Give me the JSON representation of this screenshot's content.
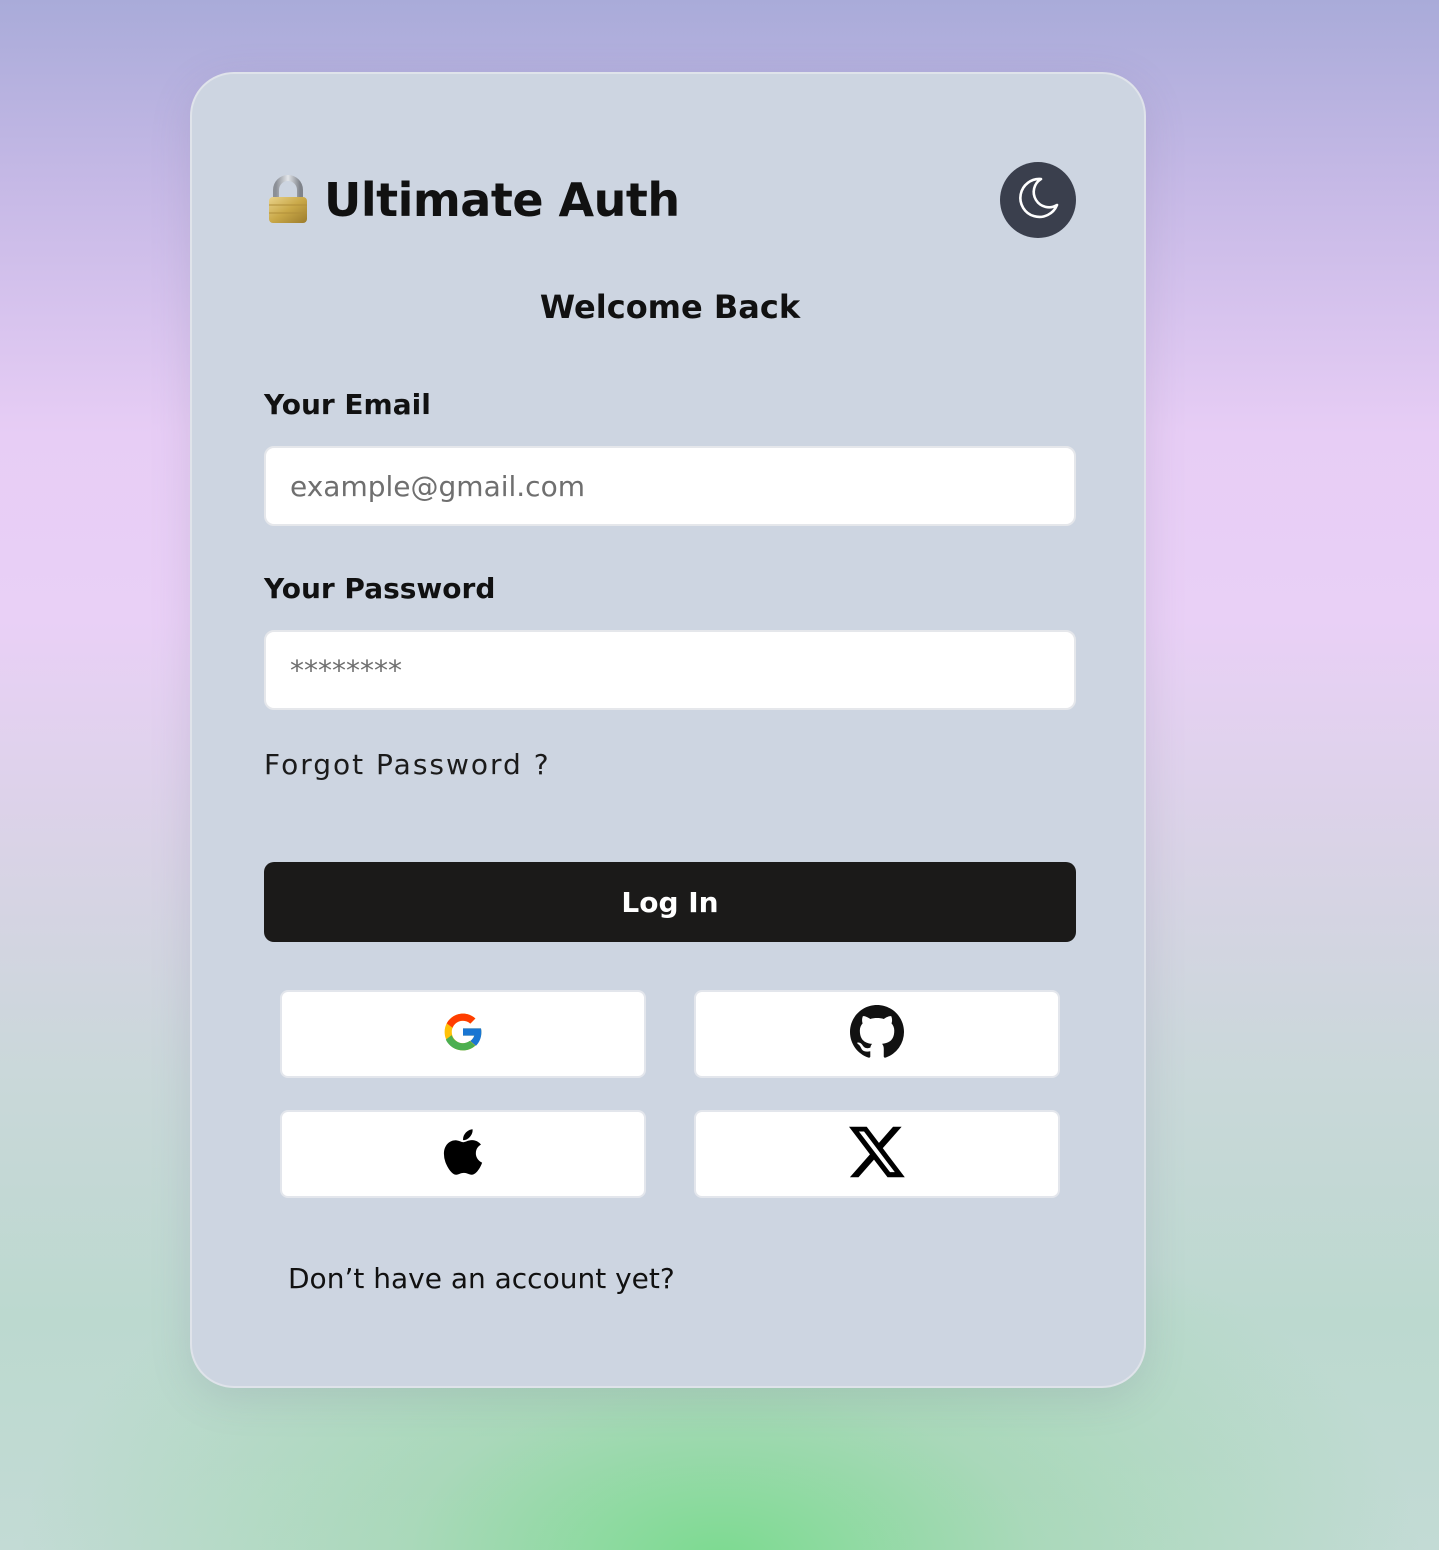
{
  "header": {
    "title": "Ultimate Auth",
    "logo_icon": "lock-icon",
    "theme_toggle_icon": "moon-icon"
  },
  "form": {
    "heading": "Welcome Back",
    "email_label": "Your Email",
    "email_placeholder": "example@gmail.com",
    "password_label": "Your Password",
    "password_placeholder": "********",
    "forgot_password": "Forgot Password ?",
    "login_label": "Log In"
  },
  "social": {
    "providers": [
      "google-icon",
      "github-icon",
      "apple-icon",
      "x-icon"
    ]
  },
  "footer": {
    "signup_prompt": "Don’t have an account yet?"
  },
  "colors": {
    "card_bg": "#cdd5e1",
    "login_button": "#1b1a19",
    "toggle_bg": "#3a3f4d"
  }
}
